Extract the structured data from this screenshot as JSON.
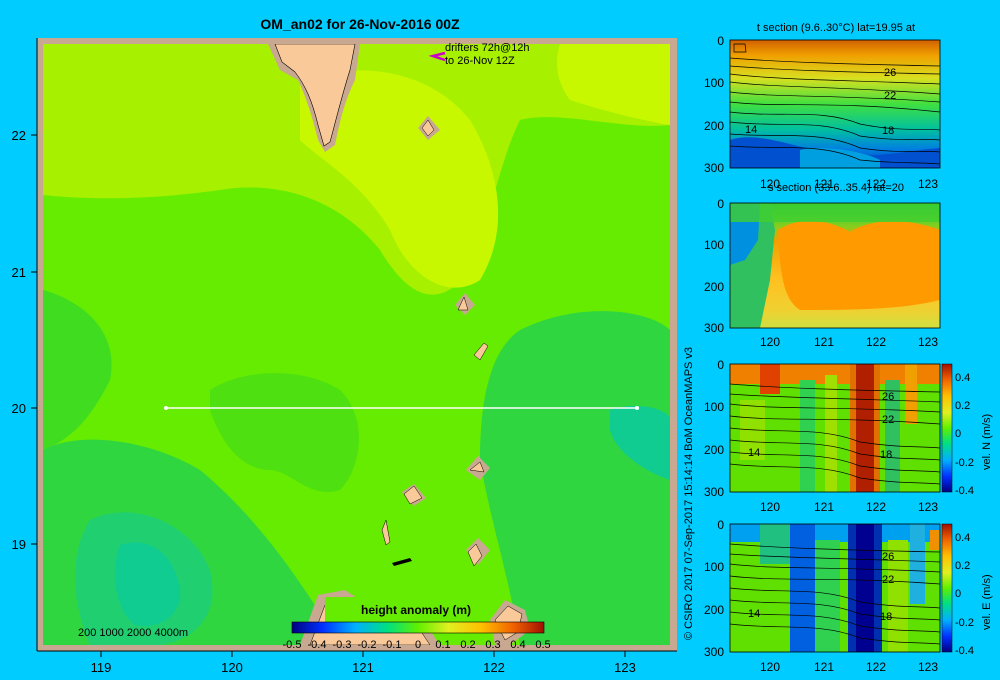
{
  "main_map": {
    "title": "OM_an02 for 26-Nov-2016 00Z",
    "drifters_line1": "drifters 72h@12h",
    "drifters_line2": "to 26-Nov 12Z",
    "x_ticks": [
      "119",
      "120",
      "121",
      "122",
      "123"
    ],
    "y_ticks": [
      "22",
      "21",
      "20",
      "19"
    ],
    "depth_legend": "200  1000  2000  4000m",
    "colorbar_title": "height anomaly (m)",
    "colorbar_ticks": [
      "-0.5",
      "-0.4",
      "-0.3",
      "-0.2",
      "-0.1",
      "0",
      "0.1",
      "0.2",
      "0.3",
      "0.4",
      "0.5"
    ]
  },
  "credit": "© CSIRO 2017   07-Sep-2017 15:14:14 BoM OceanMAPS v3",
  "sections": [
    {
      "title": "t section (9.6..30°C) lat=19.95 at",
      "contour_labels": [
        "26",
        "22",
        "18",
        "14"
      ],
      "colorbar": false
    },
    {
      "title": "s section (33.6..35.4) lat=20",
      "contour_labels": [],
      "colorbar": false
    },
    {
      "title": "",
      "contour_labels": [
        "26",
        "22",
        "18",
        "14"
      ],
      "colorbar": true,
      "colorbar_label": "vel. N (m/s)",
      "colorbar_ticks": [
        "0.4",
        "0.2",
        "0",
        "-0.2",
        "-0.4"
      ]
    },
    {
      "title": "",
      "contour_labels": [
        "26",
        "22",
        "18",
        "14"
      ],
      "colorbar": true,
      "colorbar_label": "vel. E (m/s)",
      "colorbar_ticks": [
        "0.4",
        "0.2",
        "0",
        "-0.2",
        "-0.4"
      ]
    }
  ],
  "section_axes": {
    "x_ticks": [
      "120",
      "121",
      "122",
      "123"
    ],
    "y_ticks": [
      "0",
      "100",
      "200",
      "300"
    ]
  },
  "colors": {
    "background": "#00ccff",
    "land": "#f9c99a",
    "shelf": "#c8a890"
  }
}
